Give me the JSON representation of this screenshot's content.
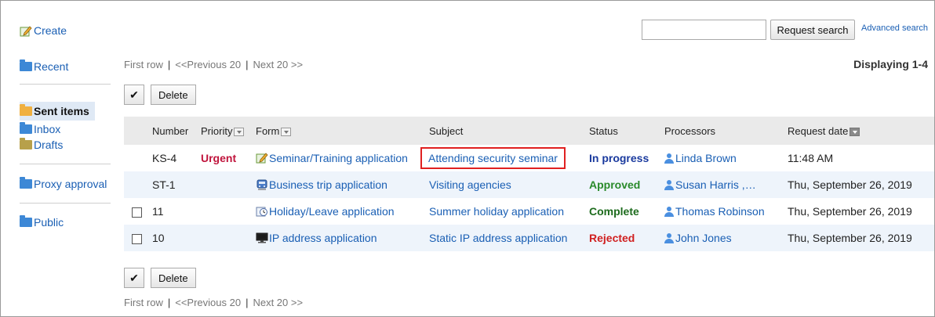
{
  "toolbar": {
    "create_label": "Create",
    "search_placeholder": "",
    "search_button": "Request search",
    "advanced_search": "Advanced search"
  },
  "sidebar": {
    "items": [
      {
        "label": "Recent"
      },
      {
        "label": "Sent items"
      },
      {
        "label": "Inbox"
      },
      {
        "label": "Drafts"
      },
      {
        "label": "Proxy approval"
      },
      {
        "label": "Public"
      }
    ],
    "selected": "Sent items"
  },
  "pager": {
    "first": "First row",
    "prev": "<<Previous 20",
    "next": "Next 20 >>",
    "displaying": "Displaying 1-4"
  },
  "actions": {
    "check_glyph": "✔",
    "delete_label": "Delete"
  },
  "table": {
    "headers": {
      "number": "Number",
      "priority": "Priority",
      "form": "Form",
      "subject": "Subject",
      "status": "Status",
      "processors": "Processors",
      "request_date": "Request date"
    },
    "rows": [
      {
        "checkbox": false,
        "number": "KS-4",
        "priority": "Urgent",
        "form": "Seminar/Training application",
        "form_icon": "memo-pencil-icon",
        "subject": "Attending security seminar",
        "status": "In progress",
        "processor": "Linda Brown",
        "date": "11:48 AM"
      },
      {
        "checkbox": false,
        "number": "ST-1",
        "priority": "",
        "form": "Business trip application",
        "form_icon": "train-icon",
        "subject": "Visiting agencies",
        "status": "Approved",
        "processor": "Susan Harris ,…",
        "date": "Thu, September 26, 2019"
      },
      {
        "checkbox": true,
        "number": "11",
        "priority": "",
        "form": "Holiday/Leave application",
        "form_icon": "calendar-clock-icon",
        "subject": "Summer holiday application",
        "status": "Complete",
        "processor": "Thomas Robinson",
        "date": "Thu, September 26, 2019"
      },
      {
        "checkbox": true,
        "number": "10",
        "priority": "",
        "form": "IP address application",
        "form_icon": "computer-icon",
        "subject": "Static IP address application",
        "status": "Rejected",
        "processor": "John Jones",
        "date": "Thu, September 26, 2019"
      }
    ]
  },
  "colors": {
    "link": "#1a5fb4",
    "urgent": "#c0143c",
    "in_progress": "#1a3a9e",
    "approved": "#2a8a2a",
    "complete": "#1d6b1d",
    "rejected": "#d02020",
    "highlight_box": "#e02020"
  }
}
